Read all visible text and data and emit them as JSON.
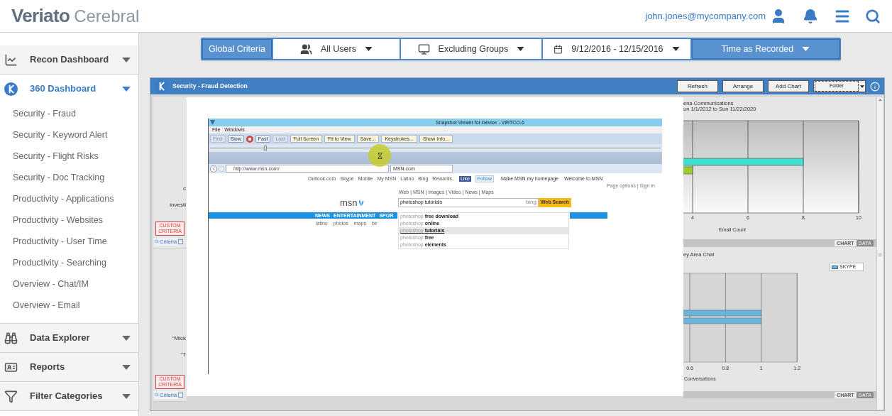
{
  "header": {
    "brand": "Veriato",
    "product": "Cerebral",
    "user_email": "john.jones@mycompany.com"
  },
  "criteria": {
    "label": "Global Criteria",
    "items": [
      {
        "kind": "users",
        "label": "All Users"
      },
      {
        "kind": "groups",
        "label": "Excluding Groups"
      },
      {
        "kind": "date",
        "label": "9/12/2016 - 12/15/2016"
      },
      {
        "kind": "time",
        "label": "Time as Recorded"
      }
    ]
  },
  "sidebar": {
    "sections": [
      {
        "kind": "recon",
        "label": "Recon Dashboard",
        "expanded": false
      },
      {
        "kind": "dashboard",
        "label": "360 Dashboard",
        "expanded": true,
        "children": [
          {
            "label": "Security - Fraud"
          },
          {
            "label": "Security - Keyword Alert"
          },
          {
            "label": "Security - Flight Risks"
          },
          {
            "label": "Security - Doc Tracking"
          },
          {
            "label": "Productivity - Applications"
          },
          {
            "label": "Productivity - Websites"
          },
          {
            "label": "Productivity - User Time"
          },
          {
            "label": "Productivity - Searching"
          },
          {
            "label": "Overview - Chat/IM"
          },
          {
            "label": "Overview - Email"
          }
        ]
      },
      {
        "kind": "explorer",
        "label": "Data Explorer",
        "expanded": false
      },
      {
        "kind": "reports",
        "label": "Reports",
        "expanded": false
      },
      {
        "kind": "filter",
        "label": "Filter Categories",
        "expanded": false
      }
    ]
  },
  "panel": {
    "title": "Security - Fraud Detection",
    "buttons": [
      "Refresh",
      "Arrange",
      "Add Chart"
    ],
    "folder": "Folder",
    "left_widgets": [
      {
        "texts": [
          "c",
          "investi"
        ],
        "badge": "CUSTOM CRITERIA",
        "criteria_button": "Criteria"
      },
      {
        "texts": [
          "“Mick",
          "“T"
        ],
        "badge": "CUSTOM CRITERIA",
        "criteria_button": "Criteria"
      }
    ],
    "charts": [
      {
        "title_lines": [
          "ena Communications",
          "un 1/1/2012 to Sun 11/22/2020"
        ],
        "tabs": [
          {
            "label": "CHART",
            "selected": true
          },
          {
            "label": "DATA",
            "selected": false
          }
        ],
        "chart_data": {
          "type": "bar",
          "orientation": "horizontal",
          "xlabel": "Email Count",
          "xlim": [
            0,
            10
          ],
          "xticks": [
            4,
            6,
            8,
            10
          ],
          "grid": true,
          "series": [
            {
              "color": "#40e0d0",
              "values": [
                8
              ]
            },
            {
              "color": "#9acd32",
              "values": [
                4
              ]
            }
          ]
        }
      },
      {
        "title_lines": [
          "ey Area Chat"
        ],
        "tabs": [
          {
            "label": "CHART",
            "selected": true
          },
          {
            "label": "DATA",
            "selected": false
          }
        ],
        "chart_data": {
          "type": "bar",
          "orientation": "horizontal",
          "xlabel": "Conversations",
          "xlim": [
            0,
            1.2
          ],
          "xticks": [
            0.6,
            0.8,
            1,
            1.2
          ],
          "grid": true,
          "series": [
            {
              "name": "SKYPE",
              "color": "#6cb4d8",
              "values": [
                1
              ]
            },
            {
              "color": "#6cb4d8",
              "values": [
                1
              ]
            }
          ]
        }
      }
    ]
  },
  "snapshot": {
    "title": "Snapshot Viewer for Device - VIRTCO-6",
    "menu": [
      "File",
      "Windows"
    ],
    "toolbar": [
      {
        "kind": "nav",
        "label": "First",
        "disabled": true
      },
      {
        "kind": "nav",
        "label": "Slow",
        "disabled": false
      },
      {
        "kind": "stop"
      },
      {
        "kind": "nav",
        "label": "Fast",
        "disabled": false
      },
      {
        "kind": "nav",
        "label": "Last",
        "disabled": true
      },
      {
        "kind": "action",
        "label": "Full Screen"
      },
      {
        "kind": "action",
        "label": "Fit to View"
      },
      {
        "kind": "action",
        "label": "Save..."
      },
      {
        "kind": "action",
        "label": "Keystrokes..."
      },
      {
        "kind": "action",
        "label": "Show Info..."
      }
    ],
    "slider": {
      "level": 0.12
    },
    "browser": {
      "url": "http://www.msn.com/",
      "tab": "MSN.com"
    },
    "page": {
      "top_links": [
        "Outlook.com",
        "Skype",
        "Mobile",
        "My MSN",
        "Latino",
        "Bing",
        "Rewards"
      ],
      "like": "Like",
      "follow": "Follow",
      "homepage": "Make MSN my homepage",
      "welcome": "Welcome to MSN",
      "page_options": "Page options | Sign in",
      "scopes": "Web | MSN | Images | Video | News | Maps",
      "logo": "msn",
      "search_value": "photoshop tutorials",
      "bing": "bing",
      "search_button": "Web Search",
      "suggestions": [
        {
          "prefix": "photoshop",
          "rest": "free download",
          "selected": false
        },
        {
          "prefix": "photoshop",
          "rest": "online",
          "selected": false
        },
        {
          "prefix": "photoshop",
          "rest": "tutorials",
          "selected": true
        },
        {
          "prefix": "photoshop",
          "rest": "free",
          "selected": false
        },
        {
          "prefix": "photoshop",
          "rest": "elements",
          "selected": false
        }
      ],
      "nav": [
        "NEWS",
        "ENTERTAINMENT",
        "SPOR"
      ],
      "sublinks": [
        "latino",
        "photos",
        "maps",
        "bir"
      ]
    }
  }
}
